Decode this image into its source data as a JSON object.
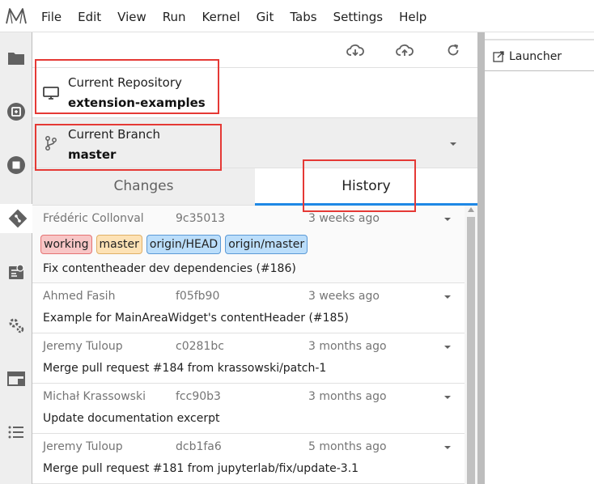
{
  "menu": {
    "items": [
      "File",
      "Edit",
      "View",
      "Run",
      "Kernel",
      "Git",
      "Tabs",
      "Settings",
      "Help"
    ]
  },
  "sidebar": {
    "icons": [
      "folder-icon",
      "running-icon",
      "stop-icon",
      "git-icon",
      "property-inspector-icon",
      "extension-icon",
      "tabs-icon",
      "toc-icon"
    ]
  },
  "git": {
    "repo_title": "Current Repository",
    "repo_name": "extension-examples",
    "branch_title": "Current Branch",
    "branch_name": "master",
    "tabs": [
      "Changes",
      "History"
    ],
    "active_tab": "History",
    "commits": [
      {
        "author": "Frédéric Collonval",
        "sha": "9c35013",
        "date": "3 weeks ago",
        "tags": [
          {
            "label": "working",
            "bg": "#f8c6c6",
            "border": "#e57373"
          },
          {
            "label": "master",
            "bg": "#fde2b5",
            "border": "#e0b067"
          },
          {
            "label": "origin/HEAD",
            "bg": "#bbdefb",
            "border": "#5c9ad6"
          },
          {
            "label": "origin/master",
            "bg": "#bbdefb",
            "border": "#5c9ad6"
          }
        ],
        "message": "Fix contentheader dev dependencies (#186)"
      },
      {
        "author": "Ahmed Fasih",
        "sha": "f05fb90",
        "date": "3 weeks ago",
        "tags": [],
        "message": "Example for MainAreaWidget's contentHeader (#185)"
      },
      {
        "author": "Jeremy Tuloup",
        "sha": "c0281bc",
        "date": "3 months ago",
        "tags": [],
        "message": "Merge pull request #184 from krassowski/patch-1"
      },
      {
        "author": "Michał Krassowski",
        "sha": "fcc90b3",
        "date": "3 months ago",
        "tags": [],
        "message": "Update documentation excerpt"
      },
      {
        "author": "Jeremy Tuloup",
        "sha": "dcb1fa6",
        "date": "5 months ago",
        "tags": [],
        "message": "Merge pull request #181 from jupyterlab/fix/update-3.1"
      }
    ]
  },
  "launcher": {
    "tab_label": "Launcher"
  },
  "colors": {
    "accent": "#1e88e5",
    "annotation": "#e53935"
  }
}
